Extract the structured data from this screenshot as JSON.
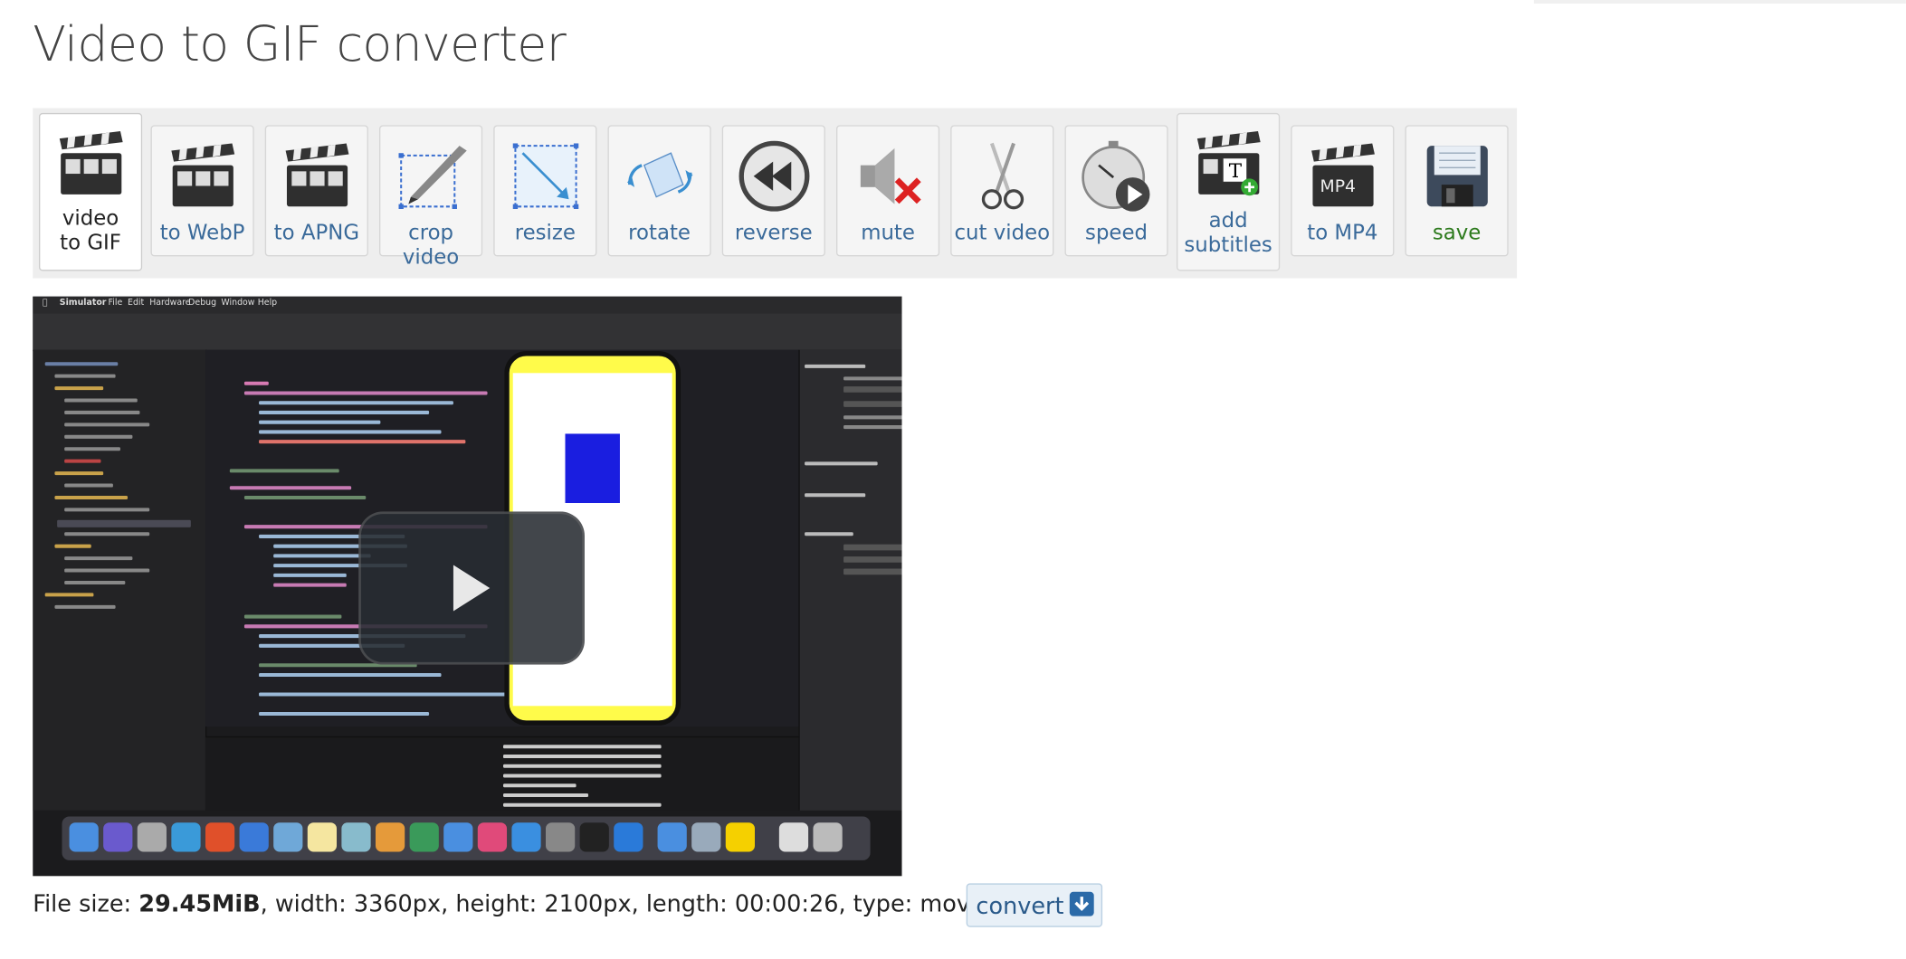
{
  "page": {
    "title": "Video to GIF converter"
  },
  "toolbar": {
    "items": [
      {
        "label": "video to GIF",
        "icon": "clapperboard-icon",
        "active": true
      },
      {
        "label": "to WebP",
        "icon": "clapperboard-icon"
      },
      {
        "label": "to APNG",
        "icon": "clapperboard-icon"
      },
      {
        "label": "crop video",
        "icon": "crop-icon"
      },
      {
        "label": "resize",
        "icon": "resize-icon"
      },
      {
        "label": "rotate",
        "icon": "rotate-icon"
      },
      {
        "label": "reverse",
        "icon": "rewind-icon"
      },
      {
        "label": "mute",
        "icon": "mute-icon"
      },
      {
        "label": "cut video",
        "icon": "scissors-icon"
      },
      {
        "label": "speed",
        "icon": "stopwatch-icon"
      },
      {
        "label": "add subtitles",
        "icon": "subtitles-icon"
      },
      {
        "label": "to MP4",
        "icon": "clapperboard-mp4-icon"
      },
      {
        "label": "save",
        "icon": "floppy-disk-icon"
      }
    ]
  },
  "file_info": {
    "size_label": "File size: ",
    "size_value": "29.45MiB",
    "rest": ", width: 3360px, height: 2100px, length: 00:00:26, type: mov"
  },
  "convert": {
    "label": "convert"
  },
  "video": {
    "menubar": [
      "Simulator",
      "File",
      "Edit",
      "Hardware",
      "Debug",
      "Window",
      "Help"
    ],
    "colors": {
      "phone": "#fffb4a",
      "box": "#1a1ee0"
    }
  }
}
